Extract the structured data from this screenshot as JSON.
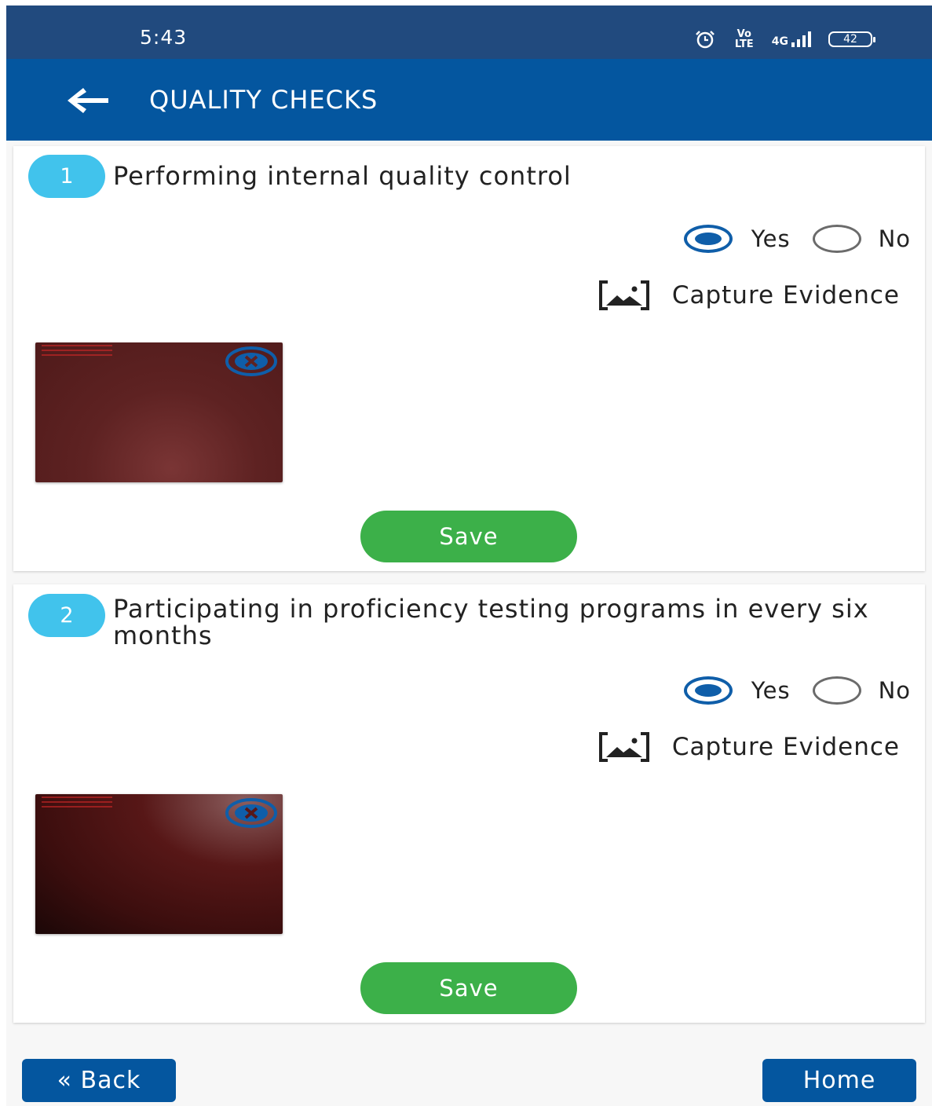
{
  "status_bar": {
    "time": "5:43",
    "volte": "Vo LTE",
    "network": "4G",
    "battery": "42"
  },
  "header": {
    "title": "QUALITY CHECKS"
  },
  "questions": [
    {
      "number": "1",
      "text": "Performing internal quality control",
      "yes_label": "Yes",
      "no_label": "No",
      "selected": "Yes",
      "capture_label": "Capture Evidence",
      "save_label": "Save"
    },
    {
      "number": "2",
      "text": "Participating in proficiency testing programs in every six months",
      "yes_label": "Yes",
      "no_label": "No",
      "selected": "Yes",
      "capture_label": "Capture Evidence",
      "save_label": "Save"
    }
  ],
  "footer": {
    "back_label": "« Back",
    "home_label": "Home"
  },
  "colors": {
    "status_bar": "#214a7e",
    "app_bar": "#04569f",
    "number_badge": "#41c3ec",
    "radio_selected": "#0f5ea9",
    "save_button": "#3cb049",
    "nav_button": "#04569f"
  },
  "icons": {
    "back": "arrow-left-icon",
    "alarm": "alarm-clock-icon",
    "signal": "signal-bars-icon",
    "battery": "battery-icon",
    "capture": "image-capture-icon",
    "remove_photo": "close-circle-icon"
  }
}
